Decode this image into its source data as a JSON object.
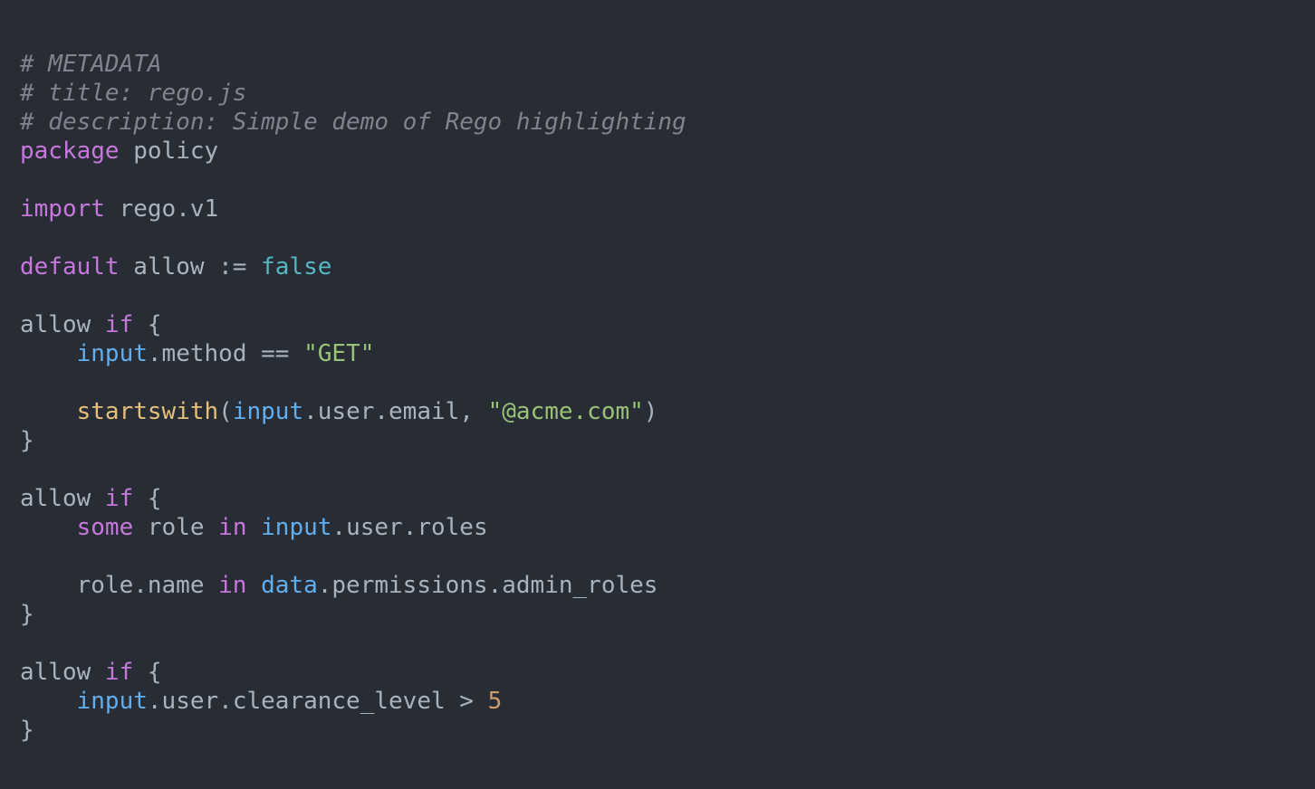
{
  "editor": {
    "colors": {
      "background": "#282c34",
      "comment": "#7f848e",
      "keyword": "#c678dd",
      "plain": "#abb2bf",
      "builtin": "#61afef",
      "string": "#98c379",
      "function": "#e5c07b",
      "number": "#d19a66",
      "boolean": "#56b6c2"
    },
    "lines": [
      [
        {
          "t": "comment",
          "v": "# METADATA"
        }
      ],
      [
        {
          "t": "comment",
          "v": "# title: rego.js"
        }
      ],
      [
        {
          "t": "comment",
          "v": "# description: Simple demo of Rego highlighting"
        }
      ],
      [
        {
          "t": "keyword",
          "v": "package"
        },
        {
          "t": "plain",
          "v": " policy"
        }
      ],
      [],
      [
        {
          "t": "keyword",
          "v": "import"
        },
        {
          "t": "plain",
          "v": " rego.v1"
        }
      ],
      [],
      [
        {
          "t": "keyword",
          "v": "default"
        },
        {
          "t": "plain",
          "v": " allow := "
        },
        {
          "t": "bool",
          "v": "false"
        }
      ],
      [],
      [
        {
          "t": "plain",
          "v": "allow "
        },
        {
          "t": "keyword",
          "v": "if"
        },
        {
          "t": "plain",
          "v": " {"
        }
      ],
      [
        {
          "t": "plain",
          "v": "    "
        },
        {
          "t": "builtin",
          "v": "input"
        },
        {
          "t": "plain",
          "v": ".method == "
        },
        {
          "t": "string",
          "v": "\"GET\""
        }
      ],
      [],
      [
        {
          "t": "plain",
          "v": "    "
        },
        {
          "t": "func",
          "v": "startswith"
        },
        {
          "t": "plain",
          "v": "("
        },
        {
          "t": "builtin",
          "v": "input"
        },
        {
          "t": "plain",
          "v": ".user.email, "
        },
        {
          "t": "string",
          "v": "\"@acme.com\""
        },
        {
          "t": "plain",
          "v": ")"
        }
      ],
      [
        {
          "t": "plain",
          "v": "}"
        }
      ],
      [],
      [
        {
          "t": "plain",
          "v": "allow "
        },
        {
          "t": "keyword",
          "v": "if"
        },
        {
          "t": "plain",
          "v": " {"
        }
      ],
      [
        {
          "t": "plain",
          "v": "    "
        },
        {
          "t": "keyword",
          "v": "some"
        },
        {
          "t": "plain",
          "v": " role "
        },
        {
          "t": "keyword",
          "v": "in"
        },
        {
          "t": "plain",
          "v": " "
        },
        {
          "t": "builtin",
          "v": "input"
        },
        {
          "t": "plain",
          "v": ".user.roles"
        }
      ],
      [],
      [
        {
          "t": "plain",
          "v": "    role.name "
        },
        {
          "t": "keyword",
          "v": "in"
        },
        {
          "t": "plain",
          "v": " "
        },
        {
          "t": "builtin",
          "v": "data"
        },
        {
          "t": "plain",
          "v": ".permissions.admin_roles"
        }
      ],
      [
        {
          "t": "plain",
          "v": "}"
        }
      ],
      [],
      [
        {
          "t": "plain",
          "v": "allow "
        },
        {
          "t": "keyword",
          "v": "if"
        },
        {
          "t": "plain",
          "v": " {"
        }
      ],
      [
        {
          "t": "plain",
          "v": "    "
        },
        {
          "t": "builtin",
          "v": "input"
        },
        {
          "t": "plain",
          "v": ".user.clearance_level > "
        },
        {
          "t": "number",
          "v": "5"
        }
      ],
      [
        {
          "t": "plain",
          "v": "}"
        }
      ]
    ]
  }
}
